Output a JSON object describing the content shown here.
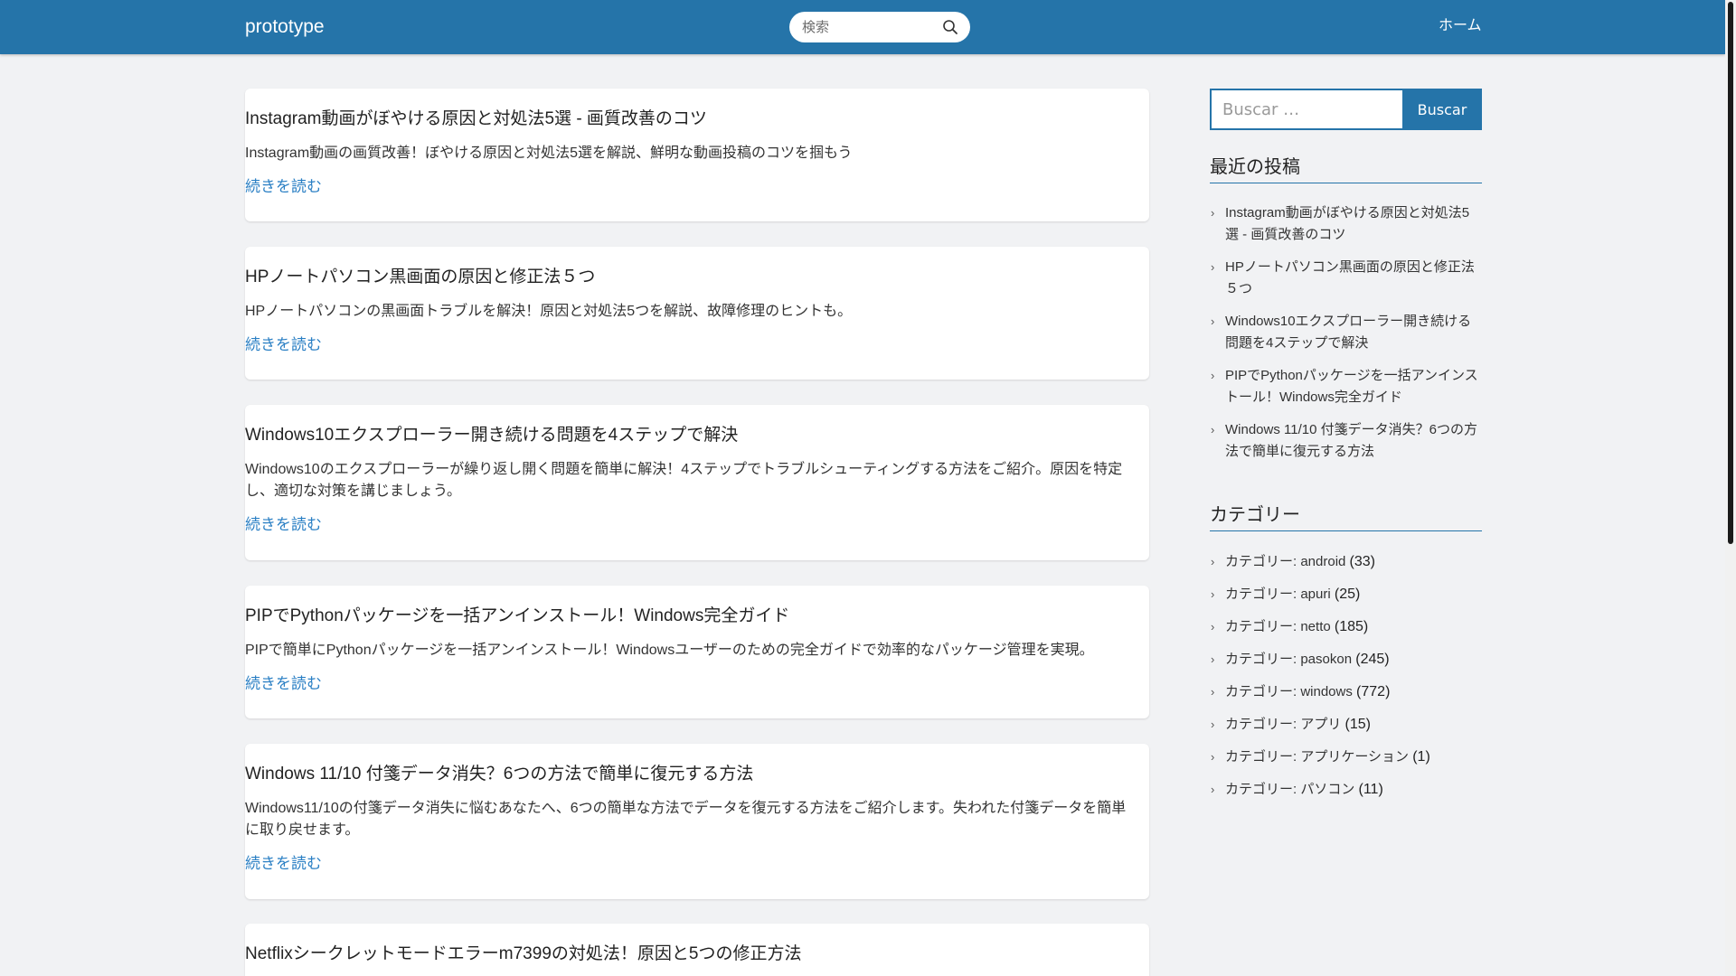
{
  "header": {
    "brand": "prototype",
    "search_placeholder": "検索",
    "nav_home": "ホーム"
  },
  "posts": [
    {
      "title": "Instagram動画がぼやける原因と対処法5選 - 画質改善のコツ",
      "excerpt": "Instagram動画の画質改善！ぼやける原因と対処法5選を解説、鮮明な動画投稿のコツを掴もう",
      "more": "続きを読む"
    },
    {
      "title": "HPノートパソコン黒画面の原因と修正法５つ",
      "excerpt": "HPノートパソコンの黒画面トラブルを解決！原因と対処法5つを解説、故障修理のヒントも。",
      "more": "続きを読む"
    },
    {
      "title": "Windows10エクスプローラー開き続ける問題を4ステップで解決",
      "excerpt": "Windows10のエクスプローラーが繰り返し開く問題を簡単に解決！4ステップでトラブルシューティングする方法をご紹介。原因を特定し、適切な対策を講じましょう。",
      "more": "続きを読む"
    },
    {
      "title": "PIPでPythonパッケージを一括アンインストール！Windows完全ガイド",
      "excerpt": "PIPで簡単にPythonパッケージを一括アンインストール！Windowsユーザーのための完全ガイドで効率的なパッケージ管理を実現。",
      "more": "続きを読む"
    },
    {
      "title": "Windows 11/10 付箋データ消失？6つの方法で簡単に復元する方法",
      "excerpt": "Windows11/10の付箋データ消失に悩むあなたへ、6つの簡単な方法でデータを復元する方法をご紹介します。失われた付箋データを簡単に取り戻せます。",
      "more": "続きを読む"
    },
    {
      "title": "Netflixシークレットモードエラーm7399の対処法！原因と5つの修正方法"
    }
  ],
  "sidebar": {
    "search_placeholder": "Buscar …",
    "search_button": "Buscar",
    "recent_title": "最近の投稿",
    "recent": [
      "Instagram動画がぼやける原因と対処法5選 - 画質改善のコツ",
      "HPノートパソコン黒画面の原因と修正法５つ",
      "Windows10エクスプローラー開き続ける問題を4ステップで解決",
      "PIPでPythonパッケージを一括アンインストール！Windows完全ガイド",
      "Windows 11/10 付箋データ消失？6つの方法で簡単に復元する方法"
    ],
    "categories_title": "カテゴリー",
    "categories": [
      {
        "name": "カテゴリー: android",
        "count": "(33)"
      },
      {
        "name": "カテゴリー: apuri",
        "count": "(25)"
      },
      {
        "name": "カテゴリー: netto",
        "count": "(185)"
      },
      {
        "name": "カテゴリー: pasokon",
        "count": "(245)"
      },
      {
        "name": "カテゴリー: windows",
        "count": "(772)"
      },
      {
        "name": "カテゴリー: アプリ",
        "count": "(15)"
      },
      {
        "name": "カテゴリー: アプリケーション",
        "count": "(1)"
      },
      {
        "name": "カテゴリー: パソコン",
        "count": "(11)"
      }
    ]
  },
  "colors": {
    "header_bg": "#2574a9",
    "link": "#2a7fc4",
    "page_bg": "#f1f2f4"
  }
}
